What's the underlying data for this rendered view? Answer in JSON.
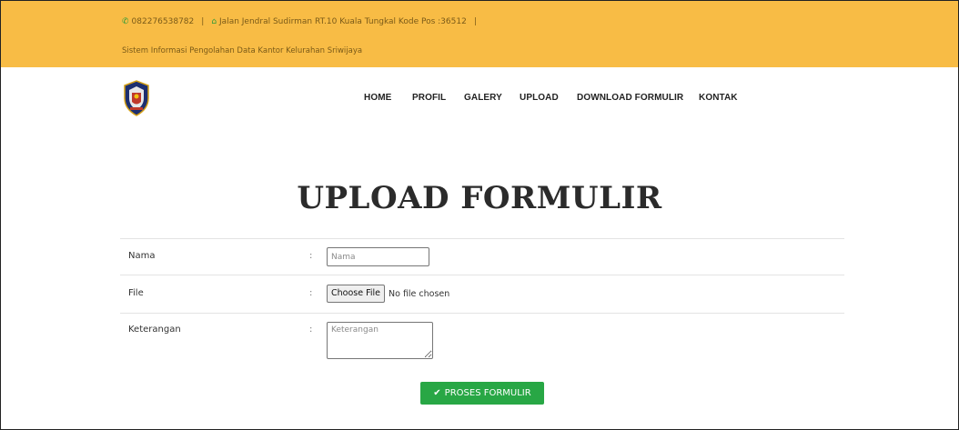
{
  "topbar": {
    "phone": "082276538782",
    "address": "Jalan Jendral Sudirman RT.10 Kuala Tungkal Kode Pos :36512",
    "separator": "|",
    "tagline": "Sistem Informasi Pengolahan Data Kantor Kelurahan Sriwijaya",
    "phone_icon": "phone-icon",
    "address_icon": "home-icon",
    "background_color": "#f8bc45"
  },
  "nav": {
    "items": [
      {
        "label": "HOME"
      },
      {
        "label": "PROFIL"
      },
      {
        "label": "GALERY"
      },
      {
        "label": "UPLOAD"
      },
      {
        "label": "DOWNLOAD FORMULIR"
      },
      {
        "label": "KONTAK"
      }
    ]
  },
  "page": {
    "title": "UPLOAD FORMULIR"
  },
  "form": {
    "colon": ":",
    "nama": {
      "label": "Nama",
      "placeholder": "Nama",
      "value": ""
    },
    "file": {
      "label": "File",
      "button_label": "Choose File",
      "status": "No file chosen"
    },
    "keterangan": {
      "label": "Keterangan",
      "placeholder": "Keterangan",
      "value": ""
    },
    "submit_label": "PROSES FORMULIR",
    "submit_icon": "check-icon",
    "submit_color": "#28a745"
  }
}
